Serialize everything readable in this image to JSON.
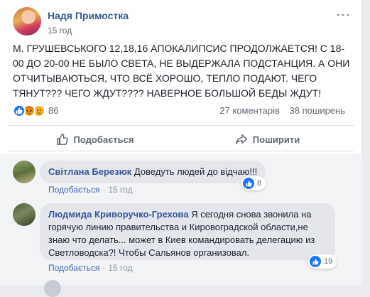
{
  "post": {
    "author": "Надя Примостка",
    "time": "15 год",
    "text": "М. ГРУШЕВСЬКОГО 12,18,16 АПОКАЛИПСИС ПРОДОЛЖАЕТСЯ! С 18-00 ДО 20-00 НЕ БЫЛО СВЕТА, НЕ ВЫДЕРЖАЛА ПОДСТАНЦИЯ. А ОНИ ОТЧИТЫВАЮТЬСЯ, ЧТО ВСЁ ХОРОШО, ТЕПЛО ПОДАЮТ. ЧЕГО ТЯНУТ??? ЧЕГО ЖДУТ???? НАВЕРНОЕ БОЛЬШОЙ БЕДЫ ЖДУТ!",
    "more": "···",
    "reactions_count": "86",
    "comments_count": "27 коментарів",
    "shares_count": "38 поширень"
  },
  "actions": {
    "like": "Подобається",
    "share": "Поширити"
  },
  "comments": [
    {
      "author": "Світлана Березюк",
      "text": "Доведуть людей до відчаю!!!",
      "like_link": "Подобається",
      "time": "15 год",
      "likes": "8"
    },
    {
      "author": "Людмида Криворучко-Грехова",
      "text": "Я сегодня снова звонила на горячую линию правительства и Кировоградской области,не знаю что делать... может в Киев командировать делегацию из Светловодска?! Чтобы Сальянов организовал.",
      "like_link": "Подобається",
      "time": "15 год",
      "likes": "19"
    }
  ],
  "colors": {
    "link": "#385898",
    "accent": "#1877f2",
    "muted": "#606770"
  },
  "icons": [
    "like-icon",
    "angry-icon",
    "sad-icon",
    "thumbs-up-icon",
    "share-icon",
    "more-options-icon"
  ]
}
